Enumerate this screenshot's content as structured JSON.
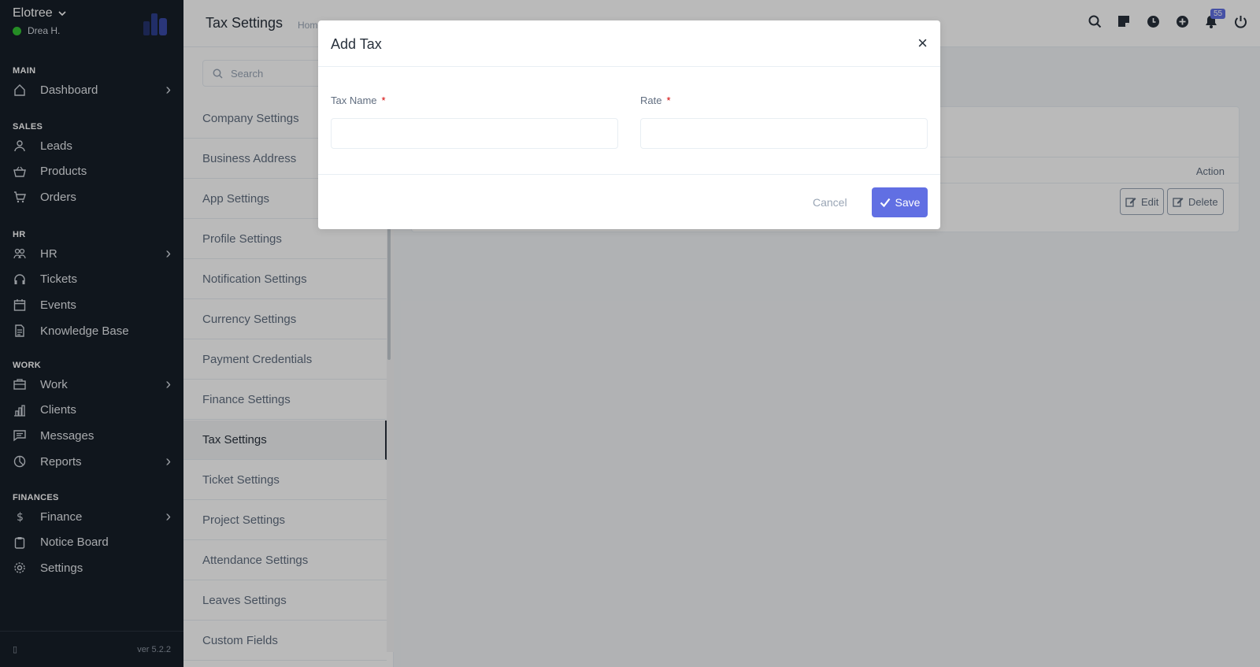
{
  "app": {
    "company": "Elotree",
    "user": "Drea H.",
    "version": "ver 5.2.2"
  },
  "sidebar": {
    "sections": [
      {
        "title": "MAIN",
        "items": [
          {
            "label": "Dashboard",
            "icon": "house-icon",
            "chevron": true
          }
        ]
      },
      {
        "title": "SALES",
        "items": [
          {
            "label": "Leads",
            "icon": "user-icon",
            "chevron": false
          },
          {
            "label": "Products",
            "icon": "basket-icon",
            "chevron": false
          },
          {
            "label": "Orders",
            "icon": "cart-icon",
            "chevron": false
          }
        ]
      },
      {
        "title": "HR",
        "items": [
          {
            "label": "HR",
            "icon": "people-icon",
            "chevron": true
          },
          {
            "label": "Tickets",
            "icon": "headset-icon",
            "chevron": false
          },
          {
            "label": "Events",
            "icon": "calendar-icon",
            "chevron": false
          },
          {
            "label": "Knowledge Base",
            "icon": "document-icon",
            "chevron": false
          }
        ]
      },
      {
        "title": "WORK",
        "items": [
          {
            "label": "Work",
            "icon": "briefcase-icon",
            "chevron": true
          },
          {
            "label": "Clients",
            "icon": "building-icon",
            "chevron": false
          },
          {
            "label": "Messages",
            "icon": "chat-icon",
            "chevron": false
          },
          {
            "label": "Reports",
            "icon": "pie-chart-icon",
            "chevron": true
          }
        ]
      },
      {
        "title": "FINANCES",
        "items": [
          {
            "label": "Finance",
            "icon": "dollar-icon",
            "chevron": true
          },
          {
            "label": "Notice Board",
            "icon": "clipboard-icon",
            "chevron": false
          },
          {
            "label": "Settings",
            "icon": "gear-icon",
            "chevron": false
          }
        ]
      }
    ]
  },
  "header": {
    "title": "Tax Settings",
    "breadcrumb": "Home",
    "notification_count": "55"
  },
  "settings_menu": {
    "search_placeholder": "Search",
    "items": [
      "Company Settings",
      "Business Address",
      "App Settings",
      "Profile Settings",
      "Notification Settings",
      "Currency Settings",
      "Payment Credentials",
      "Finance Settings",
      "Tax Settings",
      "Ticket Settings",
      "Project Settings",
      "Attendance Settings",
      "Leaves Settings",
      "Custom Fields"
    ],
    "active": "Tax Settings"
  },
  "table": {
    "action_header": "Action",
    "edit_label": "Edit",
    "delete_label": "Delete"
  },
  "modal": {
    "title": "Add Tax",
    "close": "×",
    "tax_name_label": "Tax Name",
    "rate_label": "Rate",
    "required_mark": "*",
    "tax_name_value": "",
    "rate_value": "",
    "cancel_label": "Cancel",
    "save_label": "Save"
  },
  "colors": {
    "sidebar_bg": "#171f29",
    "accent": "#616fe3",
    "required": "#d30000"
  }
}
